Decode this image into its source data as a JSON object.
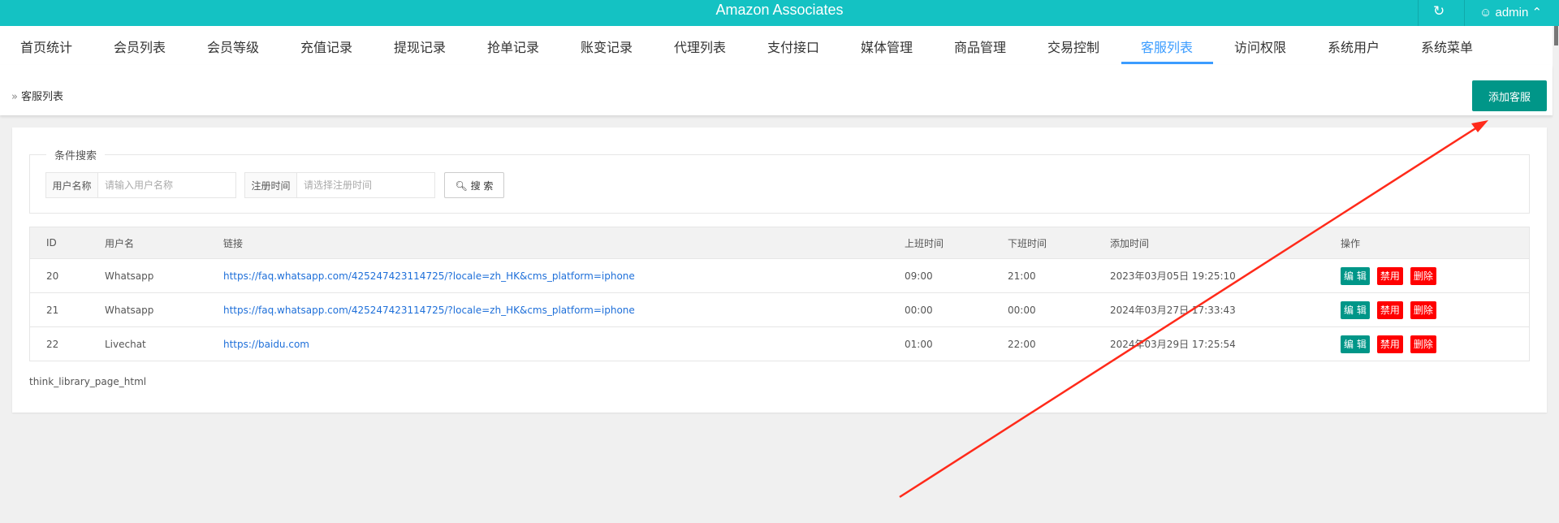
{
  "header": {
    "title": "Amazon Associates",
    "user": "admin",
    "refresh_icon": "refresh-icon",
    "user_icon": "user-icon"
  },
  "nav": {
    "tabs": [
      "首页统计",
      "会员列表",
      "会员等级",
      "充值记录",
      "提现记录",
      "抢单记录",
      "账变记录",
      "代理列表",
      "支付接口",
      "媒体管理",
      "商品管理",
      "交易控制",
      "客服列表",
      "访问权限",
      "系统用户",
      "系统菜单"
    ],
    "active": "客服列表"
  },
  "breadcrumb": {
    "label": "客服列表",
    "add_button": "添加客服"
  },
  "search": {
    "legend": "条件搜索",
    "username_label": "用户名称",
    "username_placeholder": "请输入用户名称",
    "regtime_label": "注册时间",
    "regtime_placeholder": "请选择注册时间",
    "button": "搜 索"
  },
  "table": {
    "headers": [
      "ID",
      "用户名",
      "链接",
      "上班时间",
      "下班时间",
      "添加时间",
      "操作"
    ],
    "rows": [
      {
        "id": "20",
        "name": "Whatsapp",
        "link": "https://faq.whatsapp.com/425247423114725/?locale=zh_HK&cms_platform=iphone",
        "start": "09:00",
        "end": "21:00",
        "added": "2023年03月05日 19:25:10"
      },
      {
        "id": "21",
        "name": "Whatsapp",
        "link": "https://faq.whatsapp.com/425247423114725/?locale=zh_HK&cms_platform=iphone",
        "start": "00:00",
        "end": "00:00",
        "added": "2024年03月27日 17:33:43"
      },
      {
        "id": "22",
        "name": "Livechat",
        "link": "https://baidu.com",
        "start": "01:00",
        "end": "22:00",
        "added": "2024年03月29日 17:25:54"
      }
    ],
    "actions": {
      "edit": "编 辑",
      "disable": "禁用",
      "delete": "删除"
    }
  },
  "footer": "think_library_page_html",
  "colors": {
    "header": "#14c2c3",
    "primary": "#009688",
    "danger": "#ff0000",
    "active_tab": "#3b9cff",
    "annotation_arrow": "#ff2a1a"
  }
}
